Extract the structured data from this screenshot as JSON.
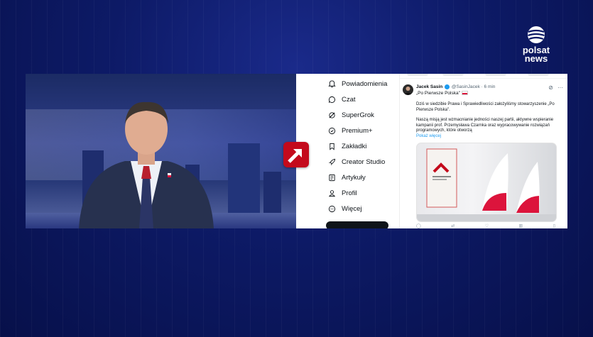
{
  "channel": {
    "logo_line1": "polsat",
    "logo_line2": "news",
    "colors": {
      "background": "#0d1a66",
      "arrow_logo": "#c40a1c"
    }
  },
  "sidebar": {
    "items": [
      {
        "label": "Powiadomienia",
        "icon": "bell-icon"
      },
      {
        "label": "Czat",
        "icon": "chat-icon"
      },
      {
        "label": "SuperGrok",
        "icon": "grok-icon"
      },
      {
        "label": "Premium+",
        "icon": "premium-icon"
      },
      {
        "label": "Zakładki",
        "icon": "bookmark-icon"
      },
      {
        "label": "Creator Studio",
        "icon": "rocket-icon"
      },
      {
        "label": "Artykuły",
        "icon": "article-icon"
      },
      {
        "label": "Profil",
        "icon": "profile-icon"
      },
      {
        "label": "Więcej",
        "icon": "more-icon"
      }
    ]
  },
  "tweet": {
    "author_name": "Jacek Sasin",
    "handle": "@SasinJacek",
    "time": "· 6 min",
    "quote": "„Po Pierwsze Polska\"",
    "paragraph1": "Dziś w siedzibie Prawa i Sprawiedliwości założyliśmy stowarzyszenie „Po Pierwsze Polska\".",
    "paragraph2": "Naszą misją jest wzmacnianie jedności naszej partii, aktywne wspieranie kampanii prof. Przemysława Czarnka oraz wypracowywanie rozwiązań programowych, które otworzą",
    "show_more": "Pokaż więcej"
  }
}
